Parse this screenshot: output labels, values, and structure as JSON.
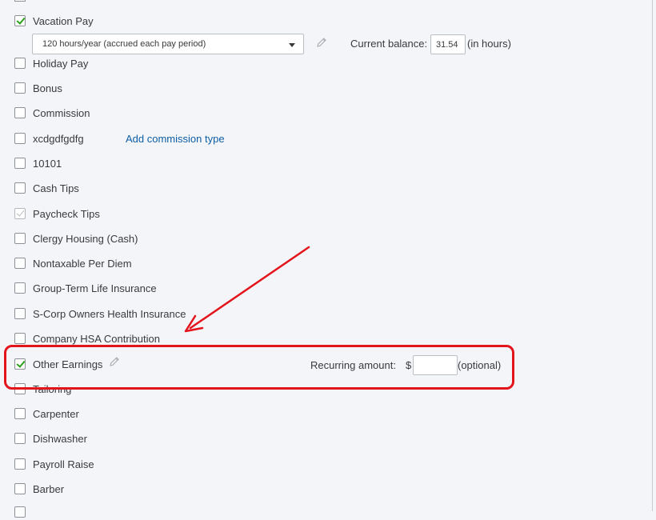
{
  "top_partial_item": {
    "label": "",
    "checked": false
  },
  "vacation_pay": {
    "label": "Vacation Pay",
    "checked": true,
    "policy_select": {
      "value": "120 hours/year (accrued each pay period)"
    },
    "current_balance_label": "Current balance:",
    "current_balance_value": "31.54",
    "balance_unit": "(in hours)"
  },
  "items": [
    {
      "label": "Holiday Pay",
      "checked": false
    },
    {
      "label": "Bonus",
      "checked": false
    },
    {
      "label": "Commission",
      "checked": false
    },
    {
      "label": "xcdgdfgdfg",
      "checked": false
    },
    {
      "label": "10101",
      "checked": false
    },
    {
      "label": "Cash Tips",
      "checked": false
    },
    {
      "label": "Paycheck Tips",
      "checked": true,
      "disabled": true
    },
    {
      "label": "Clergy Housing (Cash)",
      "checked": false
    },
    {
      "label": "Nontaxable Per Diem",
      "checked": false
    },
    {
      "label": "Group-Term Life Insurance",
      "checked": false
    },
    {
      "label": "S-Corp Owners Health Insurance",
      "checked": false
    },
    {
      "label": "Company HSA Contribution",
      "checked": false
    }
  ],
  "add_commission_link": "Add commission type",
  "other_earnings": {
    "label": "Other Earnings",
    "checked": true,
    "recurring_label": "Recurring amount:",
    "currency_symbol": "$",
    "recurring_value": "",
    "optional_text": "(optional)"
  },
  "items_below": [
    {
      "label": "Tailoring",
      "checked": false
    },
    {
      "label": "Carpenter",
      "checked": false
    },
    {
      "label": "Dishwasher",
      "checked": false
    },
    {
      "label": "Payroll Raise",
      "checked": false
    },
    {
      "label": "Barber",
      "checked": false
    }
  ],
  "colors": {
    "check": "#2ca01c",
    "link": "#0d5ea8",
    "annotation": "#e3141c"
  }
}
